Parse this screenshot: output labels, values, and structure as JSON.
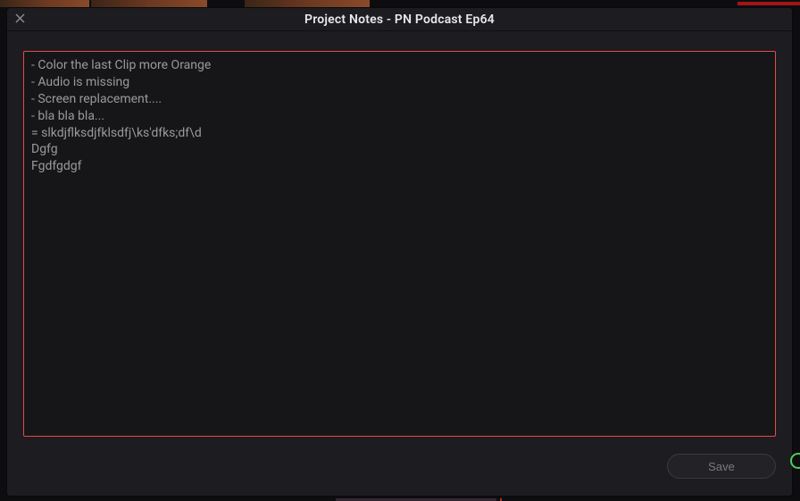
{
  "modal": {
    "title": "Project Notes - PN Podcast Ep64",
    "notes_content": "- Color the last Clip more Orange\n- Audio is missing\n- Screen replacement....\n- bla bla bla...\n= slkdjflksdjfklsdfj\\ks'dfks;df\\d\nDgfg\nFgdfgdgf",
    "save_label": "Save"
  }
}
